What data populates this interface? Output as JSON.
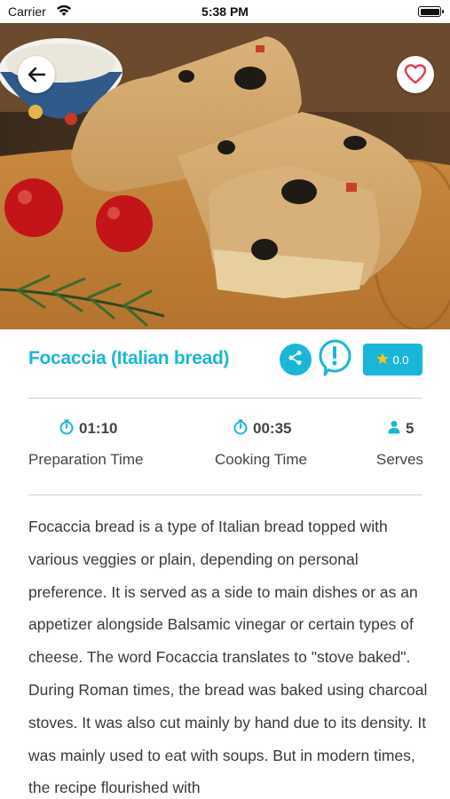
{
  "status_bar": {
    "carrier": "Carrier",
    "time": "5:38 PM"
  },
  "recipe": {
    "title": "Focaccia (Italian bread)",
    "rating": "0.0",
    "stats": {
      "prep_time": "01:10",
      "prep_label": "Preparation Time",
      "cook_time": "00:35",
      "cook_label": "Cooking Time",
      "serves": "5",
      "serves_label": "Serves"
    },
    "description": "Focaccia bread is a type of Italian bread topped with various veggies or plain, depending on personal preference. It is served as a side to main dishes or as an appetizer alongside Balsamic vinegar or certain types of cheese. The word Focaccia translates to \"stove baked\". During Roman times, the bread was baked using charcoal stoves. It was also cut mainly by hand due to its density. It was mainly used to eat with soups. But in modern times, the recipe flourished with"
  },
  "icons": {
    "back": "arrow-left-icon",
    "favorite": "heart-outline-icon",
    "share": "share-icon",
    "report": "exclamation-bubble-icon",
    "rating": "star-icon",
    "prep": "stopwatch-icon",
    "cook": "stopwatch-icon",
    "serves": "person-icon"
  },
  "colors": {
    "accent": "#1ab6d8",
    "heart": "#e8384f"
  }
}
